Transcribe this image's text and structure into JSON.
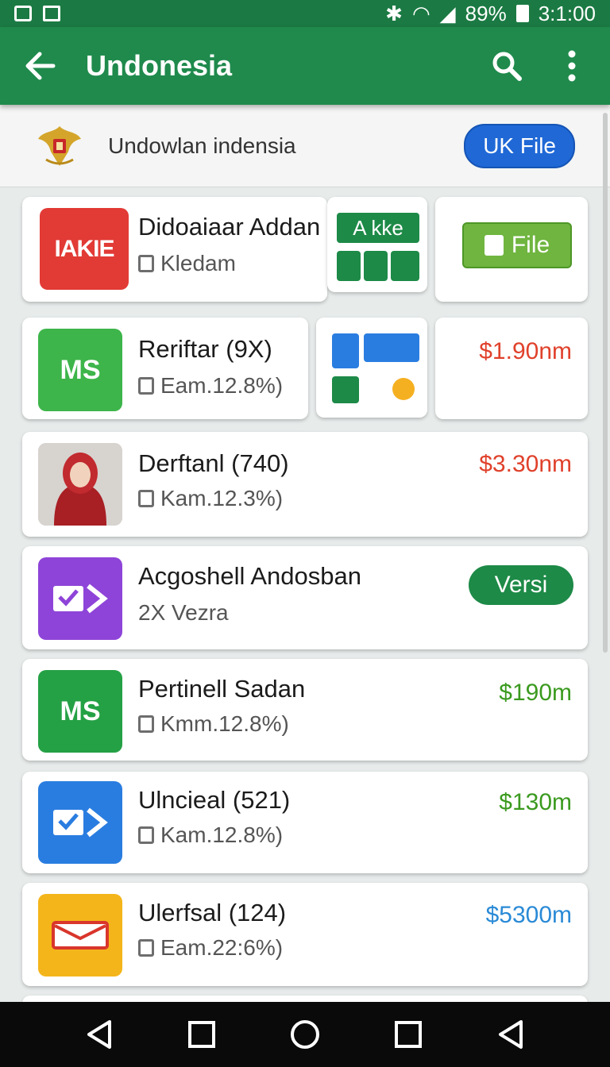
{
  "status": {
    "battery": "89%",
    "time": "3:1:00"
  },
  "appbar": {
    "title": "Undonesia"
  },
  "header": {
    "text": "Undowlan indensia",
    "button": "UK File"
  },
  "items": [
    {
      "name": "Didoaiaar Addan",
      "sub": "Kledam",
      "icon_text": "IAKIE",
      "icon_color": "#e23a35",
      "promo_label": "A kke",
      "action": "File"
    },
    {
      "name": "Reriftar (9X)",
      "sub": "Eam.12.8%)",
      "icon_text": "MS",
      "icon_color": "#3db54a",
      "price": "$1.90nm",
      "price_color": "#e0412b"
    },
    {
      "name": "Derftanl (740)",
      "sub": "Kam.12.3%)",
      "icon_text": "",
      "icon_color": "#b52a2a",
      "price": "$3.30nm",
      "price_color": "#e0412b"
    },
    {
      "name": "Acgoshell Andosban",
      "sub": "2X Vezra",
      "icon_text": "",
      "icon_color": "#8e44d8",
      "action": "Versi"
    },
    {
      "name": "Pertinell Sadan",
      "sub": "Kmm.12.8%)",
      "icon_text": "MS",
      "icon_color": "#25a145",
      "price": "$190m",
      "price_color": "#3b9a1f"
    },
    {
      "name": "Ulncieal (521)",
      "sub": "Kam.12.8%)",
      "icon_text": "",
      "icon_color": "#2a7de0",
      "price": "$130m",
      "price_color": "#3b9a1f"
    },
    {
      "name": "Ulerfsal (124)",
      "sub": "Eam.22:6%)",
      "icon_text": "",
      "icon_color": "#f4b51a",
      "price": "$5300m",
      "price_color": "#2a8ad6"
    }
  ]
}
